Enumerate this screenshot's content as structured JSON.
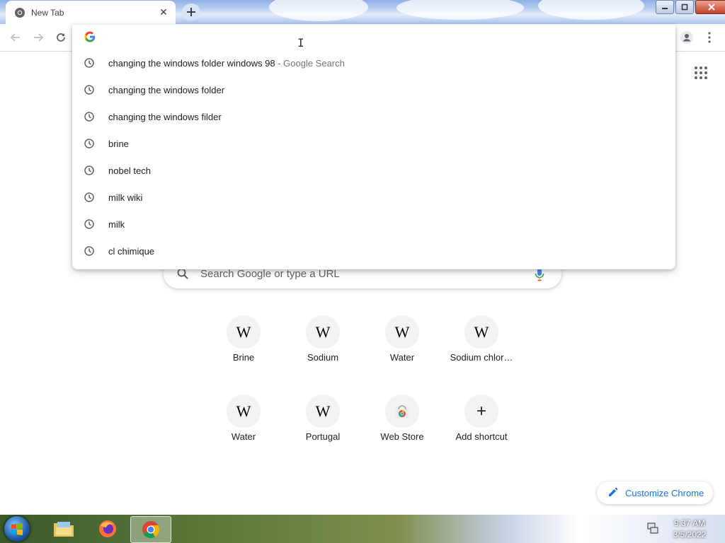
{
  "browser": {
    "tab": {
      "title": "New Tab"
    },
    "omnibox": {
      "suggestions": [
        {
          "text": "changing the windows folder windows 98",
          "suffix": " - Google Search"
        },
        {
          "text": "changing the windows folder"
        },
        {
          "text": "changing the windows filder"
        },
        {
          "text": "brine"
        },
        {
          "text": "nobel tech"
        },
        {
          "text": "milk wiki"
        },
        {
          "text": "milk"
        },
        {
          "text": "cl chimique"
        }
      ]
    }
  },
  "ntp": {
    "search_placeholder": "Search Google or type a URL",
    "shortcuts": [
      {
        "label": "Brine",
        "icon": "W"
      },
      {
        "label": "Sodium",
        "icon": "W"
      },
      {
        "label": "Water",
        "icon": "W"
      },
      {
        "label": "Sodium chlor…",
        "icon": "W"
      },
      {
        "label": "Water",
        "icon": "W"
      },
      {
        "label": "Portugal",
        "icon": "W"
      },
      {
        "label": "Web Store",
        "icon": "webstore-icon"
      },
      {
        "label": "Add shortcut",
        "icon": "+"
      }
    ],
    "customize_label": "Customize Chrome"
  },
  "taskbar": {
    "time": "9:37 AM",
    "date": "3/5/2022"
  },
  "colors": {
    "accent": "#1a73e8"
  }
}
